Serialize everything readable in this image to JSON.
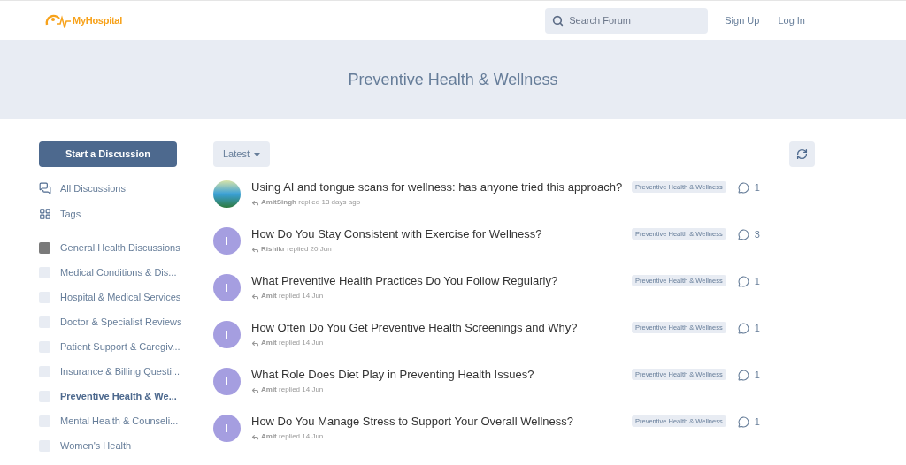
{
  "header": {
    "logo": "MyHospital",
    "search": {
      "placeholder": "Search Forum"
    },
    "links": [
      "Sign Up",
      "Log In"
    ]
  },
  "hero": {
    "title": "Preventive Health & Wellness"
  },
  "sidebar": {
    "start_button": "Start a Discussion",
    "nav": [
      {
        "kind": "discussions",
        "label": "All Discussions"
      },
      {
        "kind": "tags",
        "label": "Tags"
      }
    ],
    "tags": [
      {
        "label": "General Health Discussions",
        "color": "#7a7a7a",
        "selected": false
      },
      {
        "label": "Medical Conditions & Dis...",
        "color": "#e8ecf3",
        "selected": false
      },
      {
        "label": "Hospital & Medical Services",
        "color": "#e8ecf3",
        "selected": false
      },
      {
        "label": "Doctor & Specialist Reviews",
        "color": "#e8ecf3",
        "selected": false
      },
      {
        "label": "Patient Support & Caregiv...",
        "color": "#e8ecf3",
        "selected": false
      },
      {
        "label": "Insurance & Billing Questi...",
        "color": "#e8ecf3",
        "selected": false
      },
      {
        "label": "Preventive Health & We...",
        "color": "#e8ecf3",
        "selected": true
      },
      {
        "label": "Mental Health & Counseli...",
        "color": "#e8ecf3",
        "selected": false
      },
      {
        "label": "Women's Health",
        "color": "#e8ecf3",
        "selected": false
      }
    ]
  },
  "toolbar": {
    "sort": "Latest"
  },
  "discussions": [
    {
      "avatar": {
        "kind": "photo"
      },
      "title": "Using AI and tongue scans for wellness: has anyone tried this approach?",
      "user": "AmitSingh",
      "action": "replied",
      "time": "13 days ago",
      "tag": "Preventive Health & Wellness",
      "replies": "1"
    },
    {
      "avatar": {
        "kind": "letter",
        "letter": "I"
      },
      "title": "How Do You Stay Consistent with Exercise for Wellness?",
      "user": "Rishikr",
      "action": "replied",
      "time": "20 Jun",
      "tag": "Preventive Health & Wellness",
      "replies": "3"
    },
    {
      "avatar": {
        "kind": "letter",
        "letter": "I"
      },
      "title": "What Preventive Health Practices Do You Follow Regularly?",
      "user": "Amit",
      "action": "replied",
      "time": "14 Jun",
      "tag": "Preventive Health & Wellness",
      "replies": "1"
    },
    {
      "avatar": {
        "kind": "letter",
        "letter": "I"
      },
      "title": "How Often Do You Get Preventive Health Screenings and Why?",
      "user": "Amit",
      "action": "replied",
      "time": "14 Jun",
      "tag": "Preventive Health & Wellness",
      "replies": "1"
    },
    {
      "avatar": {
        "kind": "letter",
        "letter": "I"
      },
      "title": "What Role Does Diet Play in Preventing Health Issues?",
      "user": "Amit",
      "action": "replied",
      "time": "14 Jun",
      "tag": "Preventive Health & Wellness",
      "replies": "1"
    },
    {
      "avatar": {
        "kind": "letter",
        "letter": "I"
      },
      "title": "How Do You Manage Stress to Support Your Overall Wellness?",
      "user": "Amit",
      "action": "replied",
      "time": "14 Jun",
      "tag": "Preventive Health & Wellness",
      "replies": "1"
    }
  ]
}
